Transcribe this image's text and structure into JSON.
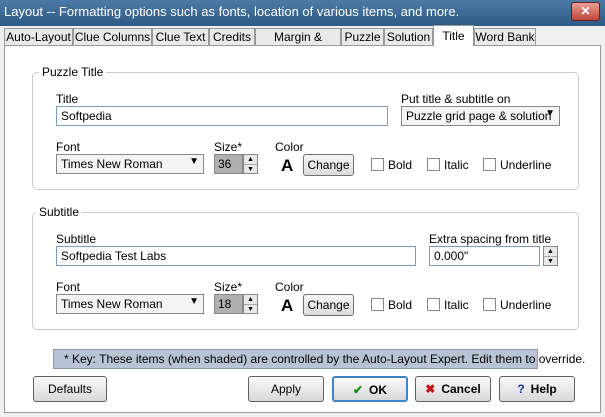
{
  "window": {
    "title": "Layout  --  Formatting options such as fonts, location of various items, and more.",
    "close_glyph": "✕"
  },
  "tabs": [
    {
      "label": "Auto-Layout"
    },
    {
      "label": "Clue Columns"
    },
    {
      "label": "Clue Text"
    },
    {
      "label": "Credits"
    },
    {
      "label": "Margin & Border"
    },
    {
      "label": "Puzzle"
    },
    {
      "label": "Solution"
    },
    {
      "label": "Title",
      "active": true
    },
    {
      "label": "Word Bank"
    }
  ],
  "puzzle_title": {
    "group_label": "Puzzle Title",
    "title_label": "Title",
    "title_value": "Softpedia",
    "put_on_label": "Put title & subtitle on",
    "put_on_value": "Puzzle grid page & solution",
    "font_label": "Font",
    "font_value": "Times New Roman",
    "size_label": "Size*",
    "size_value": "36",
    "color_label": "Color",
    "color_sample": "A",
    "change_label": "Change",
    "bold_label": "Bold",
    "italic_label": "Italic",
    "underline_label": "Underline"
  },
  "subtitle": {
    "group_label": "Subtitle",
    "subtitle_label": "Subtitle",
    "subtitle_value": "Softpedia Test Labs",
    "extra_label": "Extra spacing from title",
    "extra_value": "0.000\"",
    "font_label": "Font",
    "font_value": "Times New Roman",
    "size_label": "Size*",
    "size_value": "18",
    "color_label": "Color",
    "color_sample": "A",
    "change_label": "Change",
    "bold_label": "Bold",
    "italic_label": "Italic",
    "underline_label": "Underline"
  },
  "key_note": "* Key:  These items (when shaded) are controlled by the Auto-Layout Expert.  Edit them to override.",
  "buttons": {
    "defaults": "Defaults",
    "apply": "Apply",
    "ok": "OK",
    "cancel": "Cancel",
    "help": "Help"
  },
  "colors": {
    "titlebar": "#3a6a98",
    "key_bg": "#b8c4d6",
    "ok_icon": "#1a8a1a",
    "cancel_icon": "#c01010",
    "help_icon": "#1a3aa0"
  }
}
